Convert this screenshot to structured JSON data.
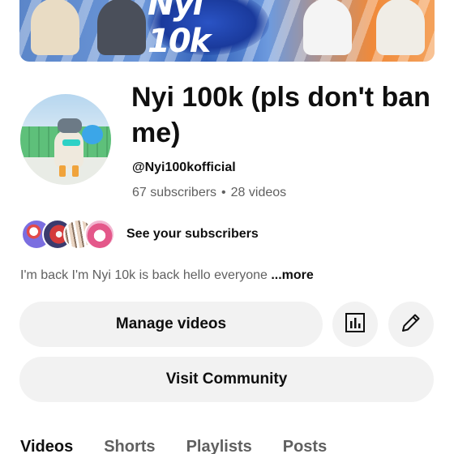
{
  "banner": {
    "logo_text": "Nyi 10k"
  },
  "channel": {
    "name": "Nyi 100k (pls don't ban me)",
    "handle": "@Nyi100kofficial",
    "subscribers": "67 subscribers",
    "separator": "•",
    "videos": "28 videos"
  },
  "subscribers_row": {
    "label": "See your subscribers"
  },
  "description": {
    "text": "I'm back I'm Nyi 10k is back hello everyone ",
    "more_label": "...more"
  },
  "actions": {
    "manage_label": "Manage videos",
    "visit_label": "Visit Community",
    "analytics_icon": "analytics-icon",
    "edit_icon": "pencil-icon"
  },
  "tabs": [
    {
      "label": "Videos",
      "active": true
    },
    {
      "label": "Shorts",
      "active": false
    },
    {
      "label": "Playlists",
      "active": false
    },
    {
      "label": "Posts",
      "active": false
    }
  ]
}
